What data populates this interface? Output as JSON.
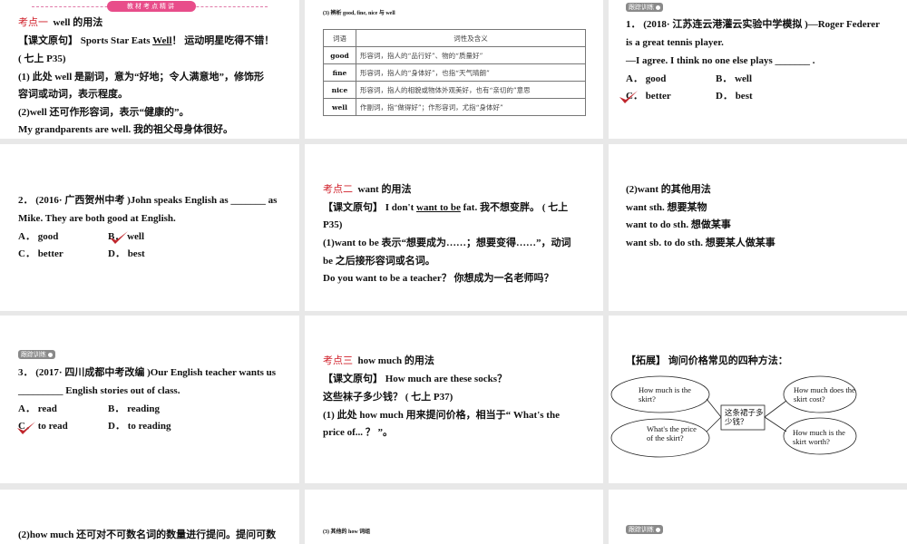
{
  "colors": {
    "accent_red": "#d0202a",
    "badge_pink": "#e84d8a",
    "check_red": "#c0272d"
  },
  "p1": {
    "banner": "教材考点精讲",
    "l1": {
      "label": "考点一",
      "text": "well 的用法"
    },
    "l2": {
      "a": "【课文原句】 Sports Star Eats ",
      "u": "Well",
      "b": "！ 运动明星吃得不错！"
    },
    "l3": "( 七上 P35)",
    "l4": "(1) 此处 well 是副词，意为“好地；令人满意地”，修饰形",
    "l5": "容词或动词，表示程度。",
    "l6": "(2)well 还可作形容词，表示“健康的”。",
    "l7": "My grandparents are well. 我的祖父母身体很好。"
  },
  "p2": {
    "heading": "(3) 辨析 good, fine, nice 与 well",
    "table": {
      "headers": [
        "词语",
        "词性及含义"
      ],
      "rows": [
        [
          "good",
          "形容词，指人的“品行好”、物的“质量好”"
        ],
        [
          "fine",
          "形容词，指人的“身体好”，也指“天气晴朗”"
        ],
        [
          "nice",
          "形容词，指人的相貌或物体外观美好，也有“亲切的”意思"
        ],
        [
          "well",
          "作副词，指“做得好”；作形容词，尤指“身体好”"
        ]
      ]
    }
  },
  "p3": {
    "badge": "跟踪训练",
    "l1": "1． (2018· 江苏连云港灌云实验中学模拟 )—Roger Federer",
    "l2": "is a great tennis player.",
    "l3": "—I agree. I think no one else plays _______ .",
    "options": [
      "A． good",
      "B． well",
      "C． better",
      "D． best"
    ]
  },
  "p4": {
    "l1": "2． (2016· 广西贺州中考 )John speaks English as _______ as",
    "l2": "Mike. They are both good at English.",
    "options": [
      "A． good",
      "B． well",
      "C． better",
      "D． best"
    ]
  },
  "p5": {
    "l1": {
      "label": "考点二",
      "text": "want 的用法"
    },
    "l2": {
      "a": "【课文原句】 I don't ",
      "u": "want to be",
      "b": " fat. 我不想变胖。 ( 七上"
    },
    "l3": "P35)",
    "l4": "(1)want to be 表示“想要成为……；想要变得……”，动词",
    "l5": "be 之后接形容词或名词。",
    "l6": "Do you want to be a teacher？ 你想成为一名老师吗？"
  },
  "p6": {
    "l1": "(2)want 的其他用法",
    "l2": "want sth. 想要某物",
    "l3": "want to do sth. 想做某事",
    "l4": "want sb. to do sth. 想要某人做某事"
  },
  "p7": {
    "badge": "跟踪训练",
    "l1": "3． (2017· 四川成都中考改编 )Our English teacher wants us",
    "l2": "_________ English stories out of class.",
    "options": [
      "A． read",
      "B． reading",
      "C． to read",
      "D． to reading"
    ]
  },
  "p8": {
    "l1": {
      "label": "考点三",
      "text": "how much 的用法"
    },
    "l2": "【课文原句】 How much are these socks？",
    "l3": "这些袜子多少钱？ ( 七上 P37)",
    "l4": "(1) 此处 how much 用来提问价格，相当于“ What's the",
    "l5": "price of... ？ ”。"
  },
  "p9": {
    "heading": "【拓展】 询问价格常见的四种方法：",
    "center": "这条裙子多少钱？",
    "q1": "How much is the skirt?",
    "q2": "What's the price of the skirt?",
    "q3": "How much does the skirt cost?",
    "q4": "How much is the skirt worth?"
  },
  "p10": {
    "l1": "(2)how much 还可对不可数名词的数量进行提问。提问可数"
  },
  "p11": {
    "heading": "(3) 其他的 how 词组"
  },
  "p12": {
    "badge": "跟踪训练"
  }
}
